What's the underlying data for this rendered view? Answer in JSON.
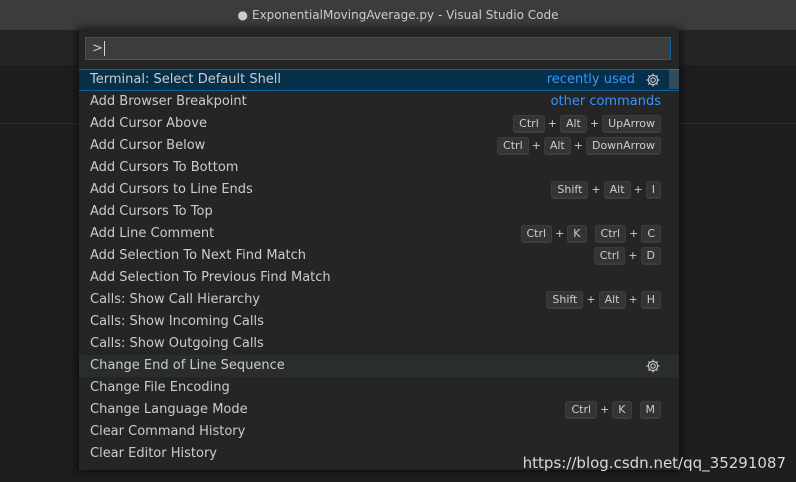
{
  "window": {
    "title": "ExponentialMovingAverage.py - Visual Studio Code",
    "dirty_marker": "●"
  },
  "palette": {
    "input_value": ">",
    "items": [
      {
        "label": "Terminal: Select Default Shell",
        "group": "recently used",
        "gear": true,
        "selected": true,
        "keys": []
      },
      {
        "label": "Add Browser Breakpoint",
        "group": "other commands",
        "keys": []
      },
      {
        "label": "Add Cursor Above",
        "keys": [
          [
            "Ctrl",
            "Alt",
            "UpArrow"
          ]
        ]
      },
      {
        "label": "Add Cursor Below",
        "keys": [
          [
            "Ctrl",
            "Alt",
            "DownArrow"
          ]
        ]
      },
      {
        "label": "Add Cursors To Bottom",
        "keys": []
      },
      {
        "label": "Add Cursors to Line Ends",
        "keys": [
          [
            "Shift",
            "Alt",
            "I"
          ]
        ]
      },
      {
        "label": "Add Cursors To Top",
        "keys": []
      },
      {
        "label": "Add Line Comment",
        "keys": [
          [
            "Ctrl",
            "K"
          ],
          [
            "Ctrl",
            "C"
          ]
        ]
      },
      {
        "label": "Add Selection To Next Find Match",
        "keys": [
          [
            "Ctrl",
            "D"
          ]
        ]
      },
      {
        "label": "Add Selection To Previous Find Match",
        "keys": []
      },
      {
        "label": "Calls: Show Call Hierarchy",
        "keys": [
          [
            "Shift",
            "Alt",
            "H"
          ]
        ]
      },
      {
        "label": "Calls: Show Incoming Calls",
        "keys": []
      },
      {
        "label": "Calls: Show Outgoing Calls",
        "keys": []
      },
      {
        "label": "Change End of Line Sequence",
        "gear": true,
        "hover": true,
        "keys": []
      },
      {
        "label": "Change File Encoding",
        "keys": []
      },
      {
        "label": "Change Language Mode",
        "keys": [
          [
            "Ctrl",
            "K"
          ],
          [
            "M"
          ]
        ]
      },
      {
        "label": "Clear Command History",
        "keys": []
      },
      {
        "label": "Clear Editor History",
        "keys": []
      }
    ]
  },
  "watermark": "https://blog.csdn.net/qq_35291087",
  "icons": {
    "gear": "gear-icon"
  },
  "colors": {
    "accent": "#0e639c",
    "group_label": "#3794ff",
    "selected_bg": "#062f4a",
    "palette_bg": "#252526",
    "title_bg": "#3c3c3c"
  }
}
